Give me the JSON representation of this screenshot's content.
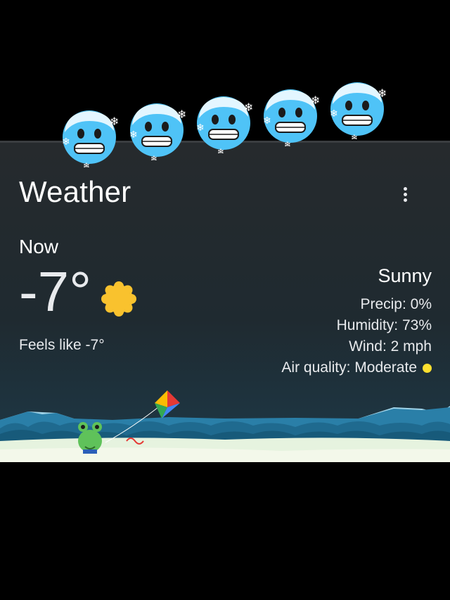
{
  "header": {
    "title": "Weather"
  },
  "current": {
    "now_label": "Now",
    "temperature": "-7°",
    "feels_like": "Feels like -7°",
    "condition": "Sunny",
    "precip": "Precip: 0%",
    "humidity": "Humidity: 73%",
    "wind": "Wind: 2 mph",
    "air_quality": "Air quality: Moderate",
    "weather_icon": "sun-icon",
    "air_quality_color": "#fde02f"
  },
  "overlay": {
    "emoji": [
      "cold-face",
      "cold-face",
      "cold-face",
      "cold-face",
      "cold-face"
    ]
  },
  "colors": {
    "card_bg": "#262a2d",
    "sun": "#f9c22e",
    "emoji_face": "#4fc3f7"
  }
}
